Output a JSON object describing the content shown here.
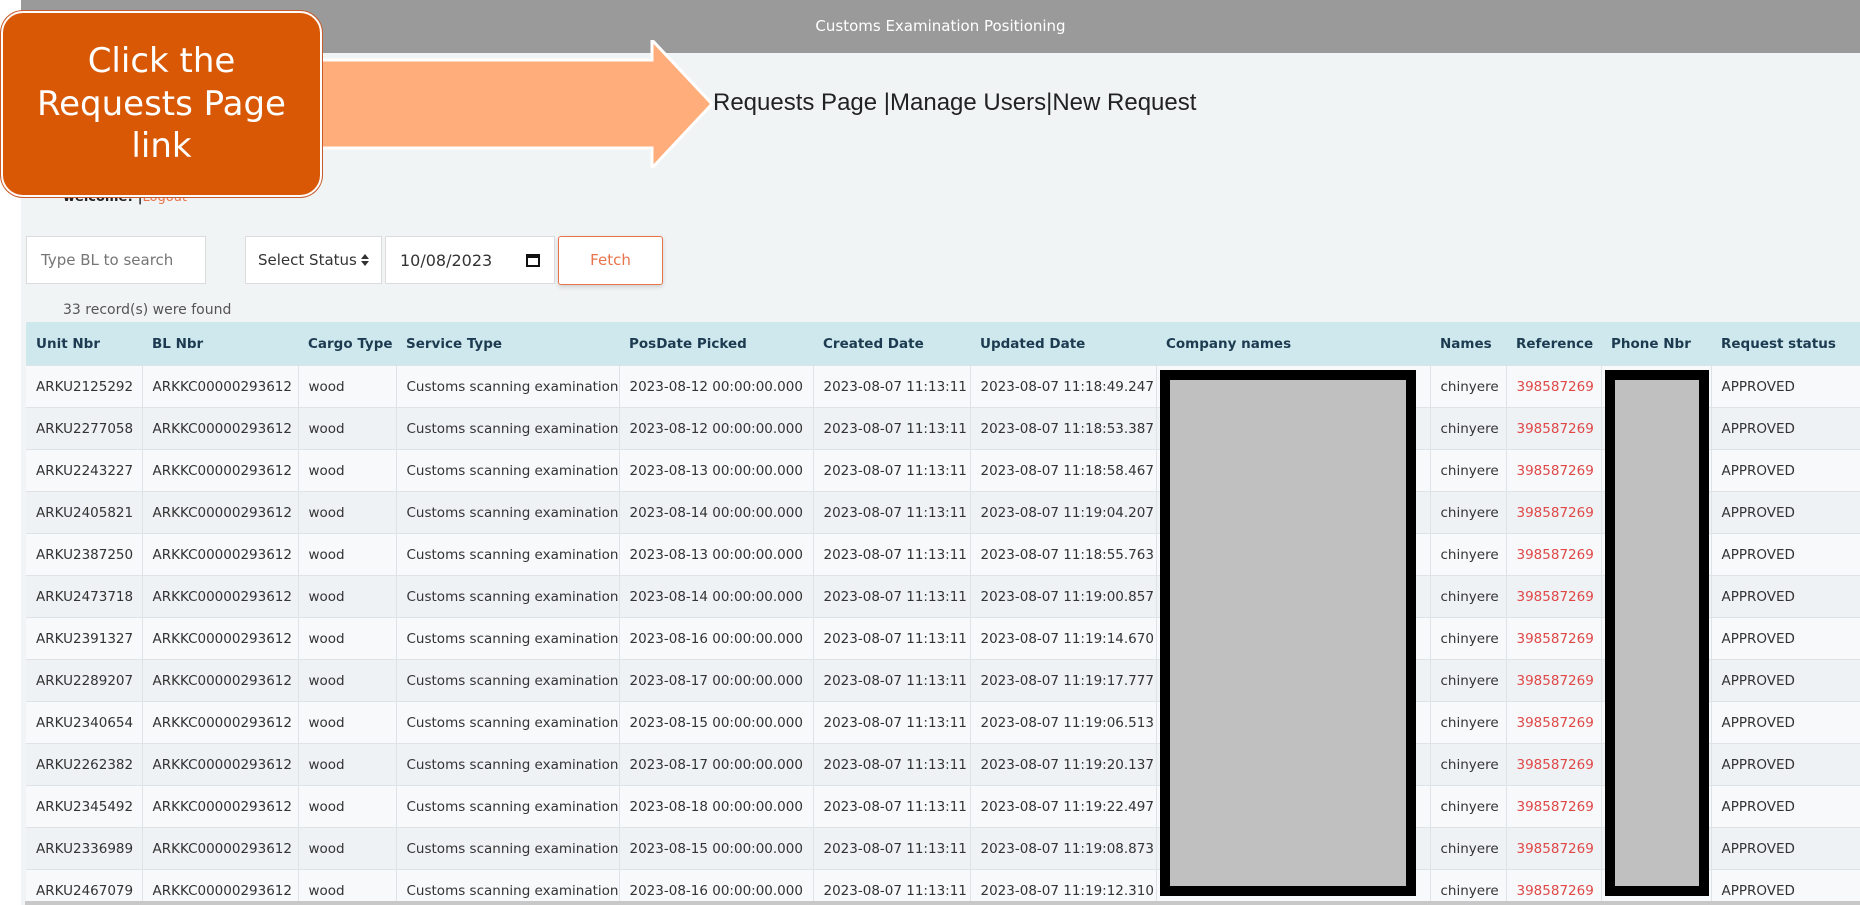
{
  "header": {
    "title": "Customs Examination Positioning"
  },
  "nav": {
    "requests": "Requests Page ",
    "sep1": "|",
    "manage": "Manage Users",
    "sep2": "|",
    "new": "New Request"
  },
  "user": {
    "welcome": "welcome! ",
    "sep": "|",
    "logout": "Logout"
  },
  "filters": {
    "search_placeholder": "Type BL to search",
    "status_label": "Select Status",
    "status_icon": "updown-icon",
    "date_value": "10/08/2023",
    "calendar_icon": "calendar-icon",
    "fetch_label": "Fetch"
  },
  "records": {
    "count_text": "33 record(s) were found"
  },
  "table": {
    "headers": [
      "Unit Nbr",
      "BL Nbr",
      "Cargo Type",
      "Service Type",
      "PosDate Picked",
      "Created Date",
      "Updated Date",
      "Company names",
      "Names",
      "Reference",
      "Phone Nbr",
      "Request status"
    ],
    "rows": [
      [
        "ARKU2125292",
        "ARKKC00000293612",
        "wood",
        "Customs scanning examination",
        "2023-08-12 00:00:00.000",
        "2023-08-07 11:13:11",
        "2023-08-07 11:18:49.247",
        "",
        "chinyere",
        "398587269",
        "",
        "APPROVED"
      ],
      [
        "ARKU2277058",
        "ARKKC00000293612",
        "wood",
        "Customs scanning examination",
        "2023-08-12 00:00:00.000",
        "2023-08-07 11:13:11",
        "2023-08-07 11:18:53.387",
        "",
        "chinyere",
        "398587269",
        "",
        "APPROVED"
      ],
      [
        "ARKU2243227",
        "ARKKC00000293612",
        "wood",
        "Customs scanning examination",
        "2023-08-13 00:00:00.000",
        "2023-08-07 11:13:11",
        "2023-08-07 11:18:58.467",
        "",
        "chinyere",
        "398587269",
        "",
        "APPROVED"
      ],
      [
        "ARKU2405821",
        "ARKKC00000293612",
        "wood",
        "Customs scanning examination",
        "2023-08-14 00:00:00.000",
        "2023-08-07 11:13:11",
        "2023-08-07 11:19:04.207",
        "",
        "chinyere",
        "398587269",
        "",
        "APPROVED"
      ],
      [
        "ARKU2387250",
        "ARKKC00000293612",
        "wood",
        "Customs scanning examination",
        "2023-08-13 00:00:00.000",
        "2023-08-07 11:13:11",
        "2023-08-07 11:18:55.763",
        "",
        "chinyere",
        "398587269",
        "",
        "APPROVED"
      ],
      [
        "ARKU2473718",
        "ARKKC00000293612",
        "wood",
        "Customs scanning examination",
        "2023-08-14 00:00:00.000",
        "2023-08-07 11:13:11",
        "2023-08-07 11:19:00.857",
        "",
        "chinyere",
        "398587269",
        "",
        "APPROVED"
      ],
      [
        "ARKU2391327",
        "ARKKC00000293612",
        "wood",
        "Customs scanning examination",
        "2023-08-16 00:00:00.000",
        "2023-08-07 11:13:11",
        "2023-08-07 11:19:14.670",
        "",
        "chinyere",
        "398587269",
        "",
        "APPROVED"
      ],
      [
        "ARKU2289207",
        "ARKKC00000293612",
        "wood",
        "Customs scanning examination",
        "2023-08-17 00:00:00.000",
        "2023-08-07 11:13:11",
        "2023-08-07 11:19:17.777",
        "",
        "chinyere",
        "398587269",
        "",
        "APPROVED"
      ],
      [
        "ARKU2340654",
        "ARKKC00000293612",
        "wood",
        "Customs scanning examination",
        "2023-08-15 00:00:00.000",
        "2023-08-07 11:13:11",
        "2023-08-07 11:19:06.513",
        "",
        "chinyere",
        "398587269",
        "",
        "APPROVED"
      ],
      [
        "ARKU2262382",
        "ARKKC00000293612",
        "wood",
        "Customs scanning examination",
        "2023-08-17 00:00:00.000",
        "2023-08-07 11:13:11",
        "2023-08-07 11:19:20.137",
        "",
        "chinyere",
        "398587269",
        "",
        "APPROVED"
      ],
      [
        "ARKU2345492",
        "ARKKC00000293612",
        "wood",
        "Customs scanning examination",
        "2023-08-18 00:00:00.000",
        "2023-08-07 11:13:11",
        "2023-08-07 11:19:22.497",
        "",
        "chinyere",
        "398587269",
        "",
        "APPROVED"
      ],
      [
        "ARKU2336989",
        "ARKKC00000293612",
        "wood",
        "Customs scanning examination",
        "2023-08-15 00:00:00.000",
        "2023-08-07 11:13:11",
        "2023-08-07 11:19:08.873",
        "",
        "chinyere",
        "398587269",
        "",
        "APPROVED"
      ],
      [
        "ARKU2467079",
        "ARKKC00000293612",
        "wood",
        "Customs scanning examination",
        "2023-08-16 00:00:00.000",
        "2023-08-07 11:13:11",
        "2023-08-07 11:19:12.310",
        "",
        "chinyere",
        "398587269",
        "",
        "APPROVED"
      ]
    ]
  },
  "annotation": {
    "callout_text": "Click the Requests Page link",
    "arrow_color": "#ffad7a",
    "callout_color": "#d95806"
  }
}
